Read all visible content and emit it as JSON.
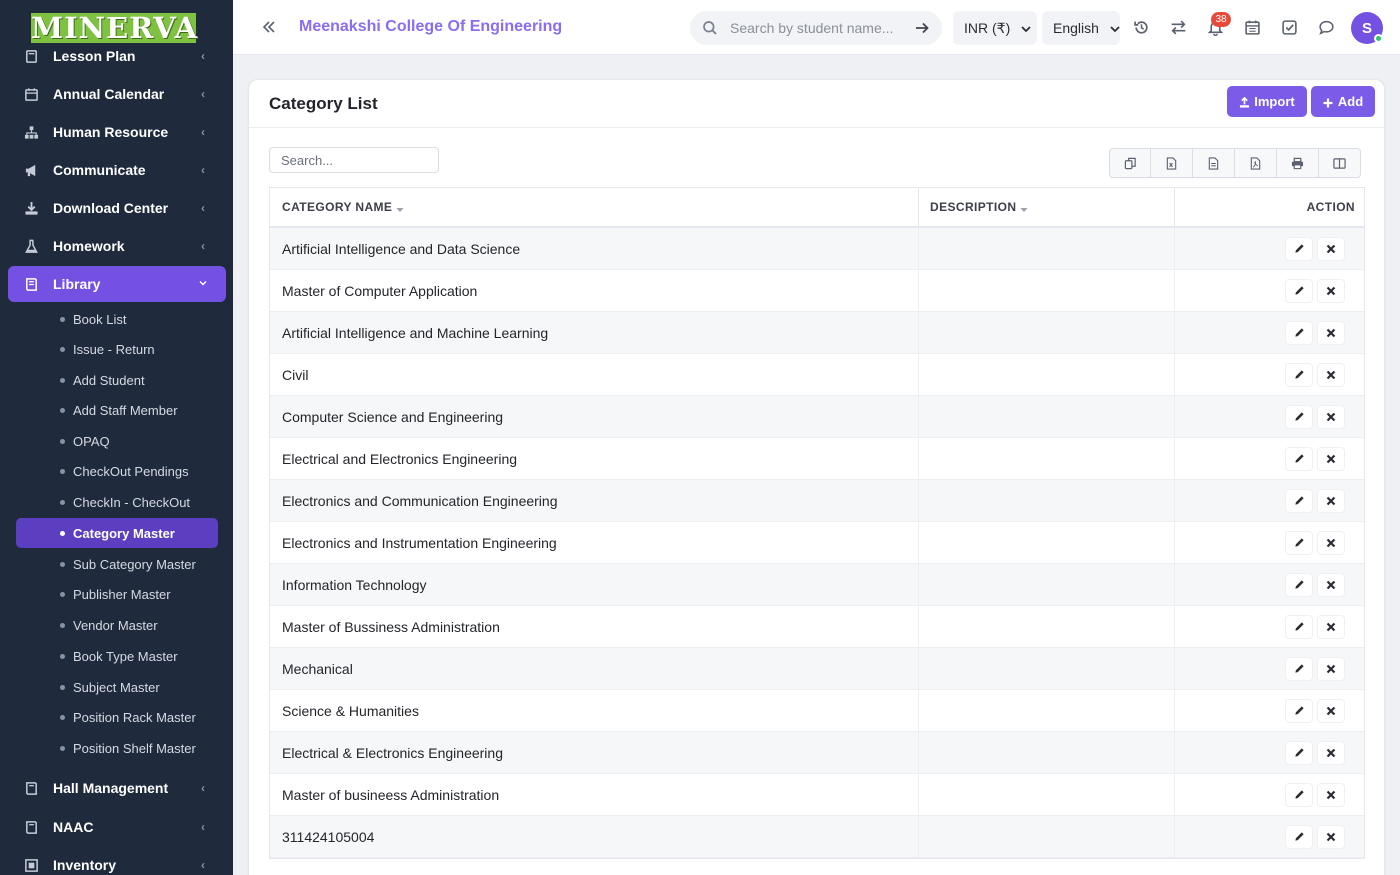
{
  "brand": {
    "logo_text": "MINERVA"
  },
  "sidebar": {
    "menu": [
      {
        "label": "Lesson Plan",
        "icon": "book-icon"
      },
      {
        "label": "Annual Calendar",
        "icon": "calendar-icon"
      },
      {
        "label": "Human Resource",
        "icon": "sitemap-icon"
      },
      {
        "label": "Communicate",
        "icon": "megaphone-icon"
      },
      {
        "label": "Download Center",
        "icon": "download-icon"
      },
      {
        "label": "Homework",
        "icon": "flask-icon"
      },
      {
        "label": "Library",
        "icon": "book-icon",
        "active": true
      }
    ],
    "library_submenu": [
      "Book List",
      "Issue - Return",
      "Add Student",
      "Add Staff Member",
      "OPAQ",
      "CheckOut Pendings",
      "CheckIn - CheckOut",
      "Category Master",
      "Sub Category Master",
      "Publisher Master",
      "Vendor Master",
      "Book Type Master",
      "Subject Master",
      "Position Rack Master",
      "Position Shelf Master"
    ],
    "active_submenu": "Category Master",
    "menu_after": [
      {
        "label": "Hall Management",
        "icon": "book-icon"
      },
      {
        "label": "NAAC",
        "icon": "book-icon"
      },
      {
        "label": "Inventory",
        "icon": "inventory-icon"
      }
    ]
  },
  "topbar": {
    "college_name": "Meenakshi College Of Engineering",
    "search_placeholder": "Search by student name...",
    "currency": "INR (₹)",
    "language": "English",
    "notification_count": "38",
    "avatar_initial": "S"
  },
  "card": {
    "title": "Category List",
    "import_label": "Import",
    "add_label": "Add",
    "search_placeholder": "Search...",
    "export_buttons": [
      "copy-icon",
      "excel-icon",
      "csv-icon",
      "pdf-icon",
      "print-icon",
      "columns-icon"
    ]
  },
  "table": {
    "headers": {
      "name": "CATEGORY NAME",
      "description": "DESCRIPTION",
      "action": "ACTION"
    },
    "rows": [
      {
        "name": "Artificial Intelligence and Data Science",
        "description": ""
      },
      {
        "name": "Master of Computer Application",
        "description": ""
      },
      {
        "name": "Artificial Intelligence and Machine Learning",
        "description": ""
      },
      {
        "name": "Civil",
        "description": ""
      },
      {
        "name": "Computer Science and Engineering",
        "description": ""
      },
      {
        "name": "Electrical and Electronics Engineering",
        "description": ""
      },
      {
        "name": "Electronics and Communication Engineering",
        "description": ""
      },
      {
        "name": "Electronics and Instrumentation Engineering",
        "description": ""
      },
      {
        "name": "Information Technology",
        "description": ""
      },
      {
        "name": "Master of Bussiness Administration",
        "description": ""
      },
      {
        "name": "Mechanical",
        "description": ""
      },
      {
        "name": "Science & Humanities",
        "description": ""
      },
      {
        "name": "Electrical & Electronics Engineering",
        "description": ""
      },
      {
        "name": "Master of busineess Administration",
        "description": ""
      },
      {
        "name": "311424105004",
        "description": ""
      }
    ]
  },
  "colors": {
    "accent": "#7551e3",
    "sidebar_bg": "#1f2a3d",
    "logo_bg": "#7fc242",
    "badge": "#e74a3b"
  }
}
